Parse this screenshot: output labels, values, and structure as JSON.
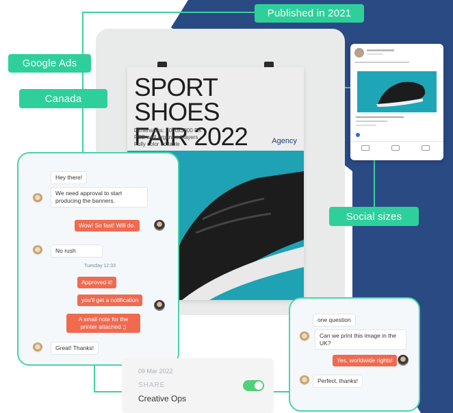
{
  "tags": {
    "published": "Published in 2021",
    "google_ads": "Google Ads",
    "canada": "Canada",
    "social_sizes": "Social sizes"
  },
  "poster": {
    "title_line1": "SPORT SHOES",
    "title_line2": "FAIR 2022",
    "meta_line1": "Dimensions: 4000x3000 PX",
    "meta_line2": "PSD well organized layers",
    "meta_line3": "Fully color editable",
    "agency": "Agency"
  },
  "chat_left": {
    "messages": [
      {
        "text": "Hey there!"
      },
      {
        "text": "We need approval to start producing the banners."
      },
      {
        "text": "Wow! So fast! Will do."
      },
      {
        "text": "No rush"
      },
      {
        "text": "Approved it!"
      },
      {
        "text": "you'll get a notification"
      },
      {
        "text": "A small note for the printer attached ;)"
      },
      {
        "text": "Great! Thanks!"
      }
    ],
    "timestamp": "Tuesday 12:33"
  },
  "chat_right": {
    "messages": [
      {
        "text": "one question"
      },
      {
        "text": "Can we print this image in the UK?"
      },
      {
        "text": "Yes, worldwide rights!"
      },
      {
        "text": "Perfect, thanks!"
      }
    ]
  },
  "share_card": {
    "date": "09 Mar 2022",
    "action": "SHARE",
    "label": "Creative Ops"
  },
  "colors": {
    "navy": "#2a4a84",
    "green": "#2fcf9c",
    "orange": "#f06a50"
  }
}
